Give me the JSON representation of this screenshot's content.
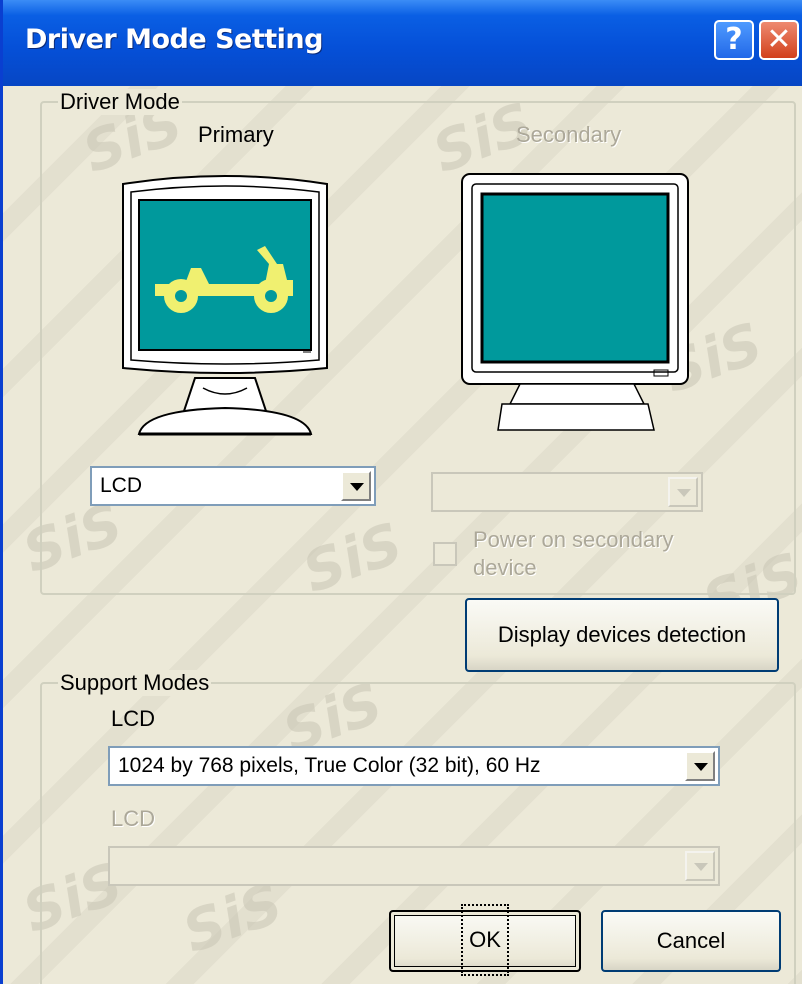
{
  "window": {
    "title": "Driver Mode Setting"
  },
  "titlebar": {
    "help_glyph": "?",
    "close_glyph": "✕"
  },
  "driver_mode": {
    "label": "Driver Mode",
    "primary": {
      "label": "Primary",
      "device_value": "LCD"
    },
    "secondary": {
      "label": "Secondary",
      "device_value": "",
      "power_checkbox_line1": "Power on secondary",
      "power_checkbox_line2": "device",
      "power_checked": false
    }
  },
  "detect_button": "Display devices detection",
  "support_modes": {
    "label": "Support Modes",
    "primary_label": "LCD",
    "primary_mode": "1024 by 768 pixels, True Color (32 bit), 60 Hz",
    "secondary_label": "LCD",
    "secondary_mode": ""
  },
  "buttons": {
    "ok": "OK",
    "cancel": "Cancel"
  },
  "watermark": "SiS",
  "colors": {
    "titlebar": "#0550d8",
    "dialog_bg": "#ece9d8",
    "screen_teal": "#00999c",
    "jeep_yellow": "#f0f070",
    "disabled_text": "#aca899"
  },
  "icons": [
    "help-icon",
    "close-icon",
    "lcd-monitor-icon",
    "crt-monitor-icon",
    "jeep-icon",
    "dropdown-arrow-icon"
  ]
}
